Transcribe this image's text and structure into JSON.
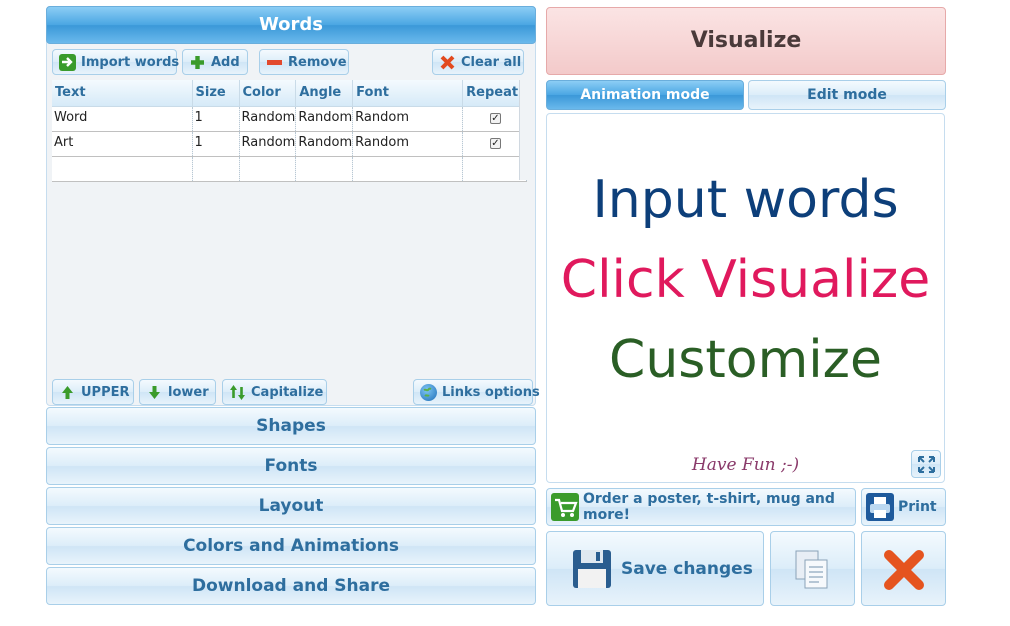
{
  "words_panel": {
    "title": "Words",
    "toolbar": {
      "import": "Import words",
      "add": "Add",
      "remove": "Remove",
      "clear": "Clear all"
    },
    "columns": [
      "Text",
      "Size",
      "Color",
      "Angle",
      "Font",
      "Repeat?"
    ],
    "rows": [
      {
        "text": "Word",
        "size": "1",
        "color": "Random",
        "angle": "Random",
        "font": "Random",
        "repeat": true
      },
      {
        "text": "Art",
        "size": "1",
        "color": "Random",
        "angle": "Random",
        "font": "Random",
        "repeat": true
      }
    ],
    "case_buttons": {
      "upper": "UPPER",
      "lower": "lower",
      "capitalize": "Capitalize",
      "links": "Links options"
    }
  },
  "sections": {
    "shapes": "Shapes",
    "fonts": "Fonts",
    "layout": "Layout",
    "colors": "Colors and Animations",
    "download": "Download and Share"
  },
  "right_panel": {
    "visualize": "Visualize",
    "tabs": {
      "animation": "Animation mode",
      "edit": "Edit mode"
    },
    "canvas": {
      "line1": "Input words",
      "line2": "Click Visualize",
      "line3": "Customize",
      "footer": "Have Fun ;-)"
    },
    "order": "Order a poster, t-shirt, mug and more!",
    "print": "Print",
    "save": "Save changes"
  },
  "colors": {
    "line1": "#0d3f7a",
    "line2": "#e0195d",
    "line3": "#2a5e25",
    "footer": "#8a3a6a",
    "visualize_bg": "#f6d3d3"
  }
}
